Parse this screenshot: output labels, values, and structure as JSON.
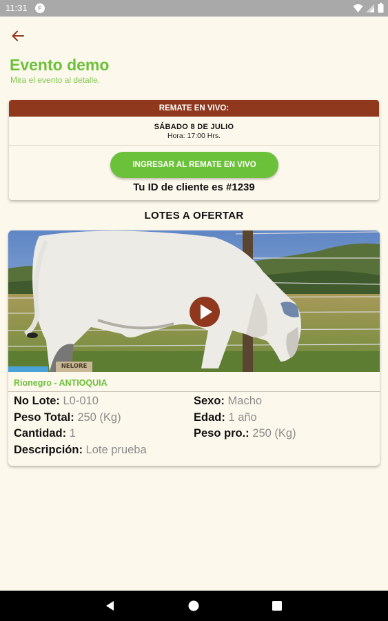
{
  "status_bar": {
    "time": "11:31",
    "app_icon": "F"
  },
  "header": {
    "title": "Evento demo",
    "subtitle": "Mira el evento al detalle."
  },
  "live_auction": {
    "header": "REMATE EN VIVO:",
    "date": "SÁBADO 8 DE JULIO",
    "time": "Hora: 17:00 Hrs.",
    "enter_button": "INGRESAR AL REMATE EN VIVO",
    "client_id": "Tu ID de cliente es #1239"
  },
  "lots_section": {
    "title": "LOTES A OFERTAR",
    "lots": [
      {
        "breed_tag": "NELORE",
        "location": "Rionegro - ANTIOQUIA",
        "fields": {
          "lote_label": "No Lote:",
          "lote_value": "L0-010",
          "peso_total_label": "Peso Total:",
          "peso_total_value": "250 (Kg)",
          "cantidad_label": "Cantidad:",
          "cantidad_value": "1",
          "descripcion_label": "Descripción:",
          "descripcion_value": "Lote prueba",
          "sexo_label": "Sexo:",
          "sexo_value": "Macho",
          "edad_label": "Edad:",
          "edad_value": "1 año",
          "peso_pro_label": "Peso pro.:",
          "peso_pro_value": "250 (Kg)"
        }
      }
    ]
  },
  "colors": {
    "accent_green": "#6cc13a",
    "brand_brown": "#8f381e",
    "background": "#fdf8ec"
  },
  "icons": [
    "back-arrow-icon",
    "play-icon",
    "wifi-icon",
    "signal-icon",
    "battery-icon",
    "nav-back-icon",
    "nav-home-icon",
    "nav-recents-icon"
  ]
}
